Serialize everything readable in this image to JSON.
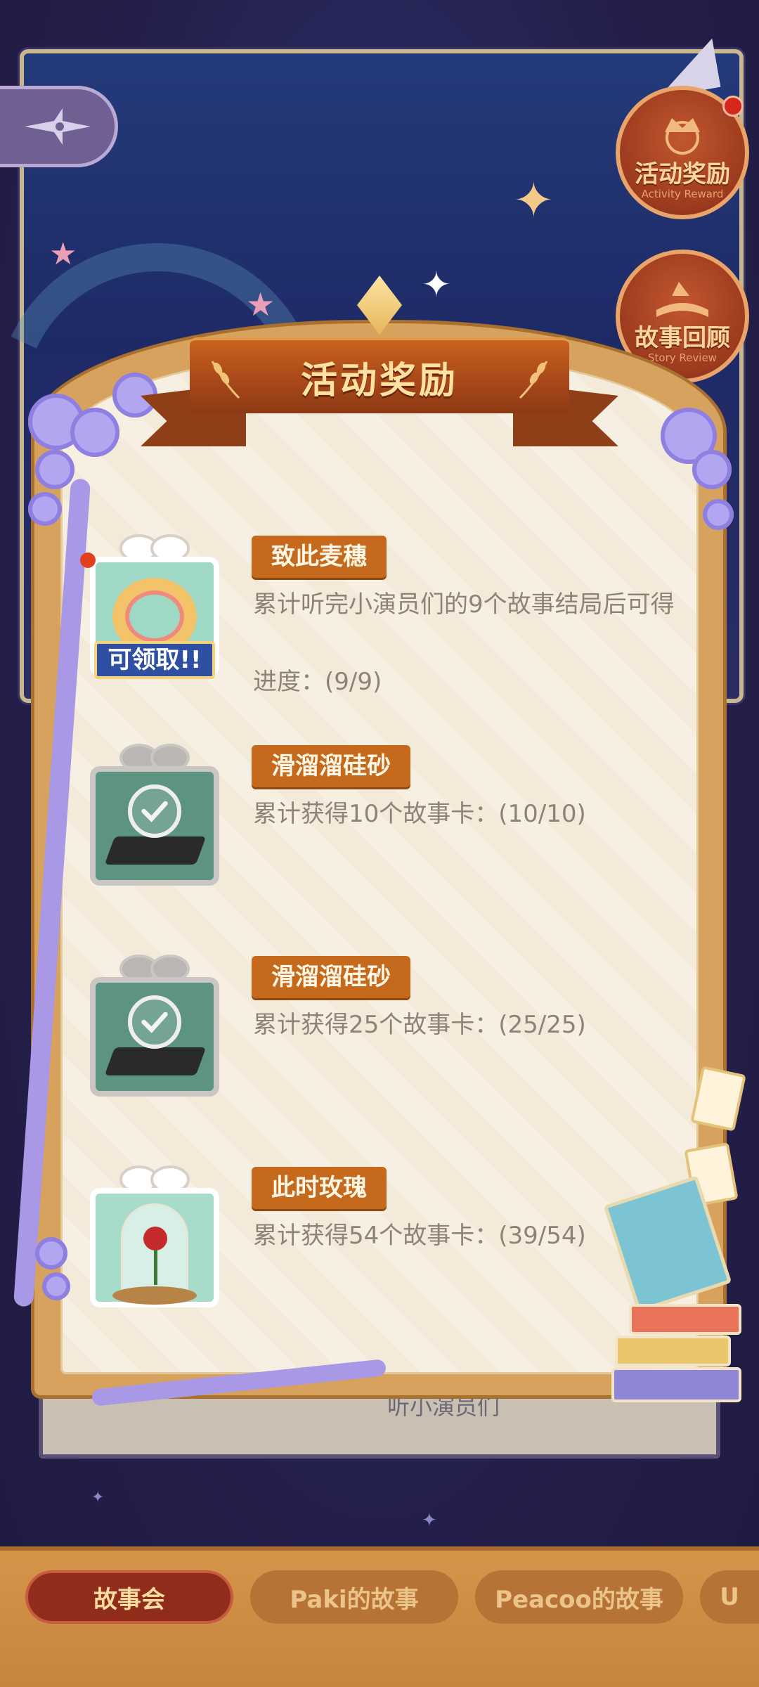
{
  "panel": {
    "title": "活动奖励",
    "behind_text": "听小演员们"
  },
  "side_badges": {
    "activity_reward": {
      "cn": "活动奖励",
      "en": "Activity Reward",
      "has_notification": true
    },
    "story_review": {
      "cn": "故事回顾",
      "en": "Story Review"
    }
  },
  "rewards": [
    {
      "name": "致此麦穗",
      "description": "累计听完小演员们的9个故事结局后可得",
      "progress_text": "进度：(9/9)",
      "claim_label": "可领取!!",
      "status": "claimable",
      "icon": "wheat-wreath-gift-icon",
      "progress": {
        "current": 9,
        "total": 9
      }
    },
    {
      "name": "滑溜溜硅砂",
      "description": "累计获得10个故事卡：(10/10)",
      "status": "claimed",
      "icon": "silica-sand-gift-icon",
      "progress": {
        "current": 10,
        "total": 10
      }
    },
    {
      "name": "滑溜溜硅砂",
      "description": "累计获得25个故事卡：(25/25)",
      "status": "claimed",
      "icon": "silica-sand-gift-icon",
      "progress": {
        "current": 25,
        "total": 25
      }
    },
    {
      "name": "此时玫瑰",
      "description": "累计获得54个故事卡：(39/54)",
      "status": "in-progress",
      "icon": "rose-dome-gift-icon",
      "progress": {
        "current": 39,
        "total": 54
      }
    }
  ],
  "tabs": [
    {
      "label": "故事会",
      "active": true
    },
    {
      "label": "Paki的故事",
      "active": false
    },
    {
      "label": "Peacoo的故事",
      "active": false
    },
    {
      "label": "U",
      "active": false
    }
  ],
  "colors": {
    "ribbon": "#a9481a",
    "name_tag": "#c56a1c",
    "parchment": "#f7efe1",
    "frame": "#d6a25d",
    "sky": "#241f4a"
  }
}
